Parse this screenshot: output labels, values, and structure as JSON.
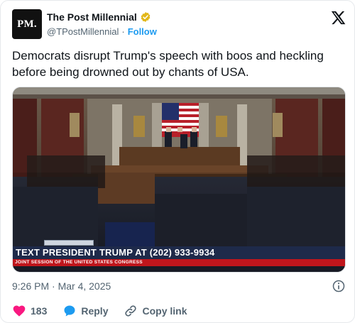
{
  "account": {
    "display_name": "The Post Millennial",
    "handle": "@TPostMillennial",
    "separator": "·",
    "follow_label": "Follow",
    "avatar_text": "PM."
  },
  "tweet": {
    "text": "Democrats disrupt Trump's speech with boos and heckling before being drowned out by chants of USA."
  },
  "media": {
    "chyron_main": "TEXT PRESIDENT TRUMP AT (202) 933-9934",
    "chyron_sub": "JOINT SESSION OF THE UNITED STATES CONGRESS"
  },
  "meta": {
    "timestamp": "9:26 PM · Mar 4, 2025"
  },
  "actions": {
    "like_count": "183",
    "reply_label": "Reply",
    "copy_link_label": "Copy link"
  },
  "colors": {
    "accent": "#1d9bf0",
    "like": "#f91880",
    "verified_gold": "#e2b719",
    "chyron_navy": "#1e2a4a",
    "chyron_red": "#c0161c"
  },
  "icons": [
    "verified-badge-icon",
    "x-logo-icon",
    "info-icon",
    "heart-icon",
    "reply-bubble-icon",
    "link-icon"
  ]
}
